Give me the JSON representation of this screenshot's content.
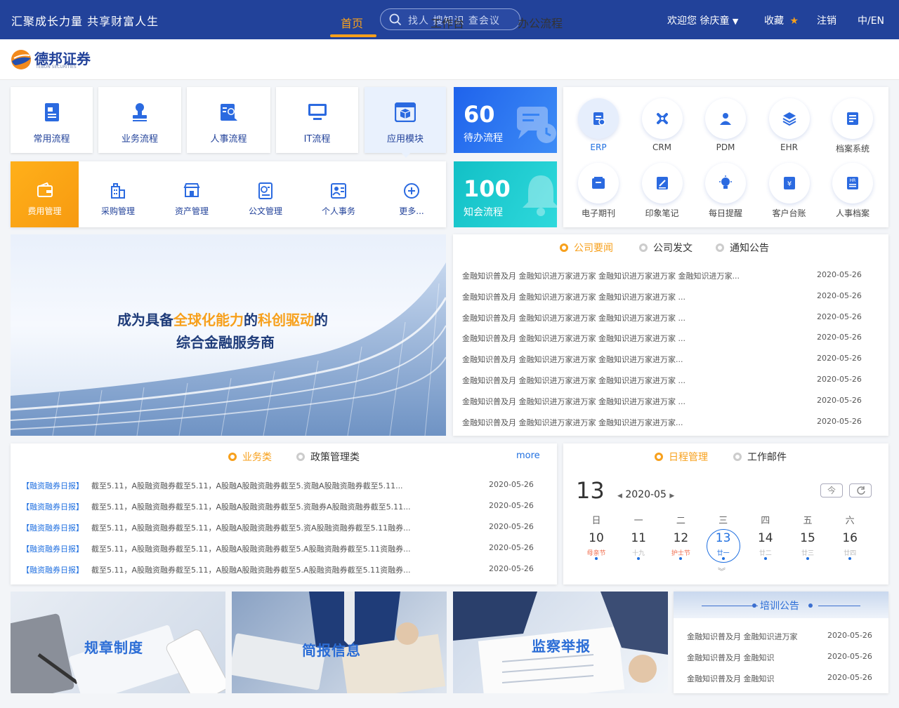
{
  "header": {
    "slogan": "汇聚成长力量 共享财富人生",
    "search_placeholder": "找人 搜知识 查会议",
    "welcome": "欢迎您 徐庆童",
    "favorites": "收藏",
    "logout": "注销",
    "language": "中/EN"
  },
  "brand": {
    "name_cn": "德邦证券",
    "name_en": "TEBON SECURITIES"
  },
  "nav": {
    "tabs": [
      "首页",
      "工作台",
      "办公流程"
    ],
    "active": "首页"
  },
  "modules_row1": [
    "常用流程",
    "业务流程",
    "人事流程",
    "IT流程",
    "应用模块"
  ],
  "modules_row2": [
    "费用管理",
    "采购管理",
    "资产管理",
    "公文管理",
    "个人事务",
    "更多..."
  ],
  "stats": {
    "pending": {
      "count": "60",
      "label": "待办流程"
    },
    "notify": {
      "count": "100",
      "label": "知会流程"
    }
  },
  "apps": [
    "ERP",
    "CRM",
    "PDM",
    "EHR",
    "档案系统",
    "电子期刊",
    "印象笔记",
    "每日提醒",
    "客户台账",
    "人事档案"
  ],
  "banner": {
    "line1_a": "成为具备",
    "line1_b": "全球化能力",
    "line1_c": "的",
    "line1_d": "科创驱动",
    "line1_e": "的",
    "line2": "综合金融服务商"
  },
  "news": {
    "tabs": [
      "公司要闻",
      "公司发文",
      "通知公告"
    ],
    "items": [
      {
        "text": "金融知识普及月  金融知识进万家进万家  金融知识进万家进万家 金融知识进万家...",
        "date": "2020-05-26"
      },
      {
        "text": "金融知识普及月  金融知识进万家进万家  金融知识进万家进万家 ...",
        "date": "2020-05-26"
      },
      {
        "text": "金融知识普及月  金融知识进万家进万家  金融知识进万家进万家 ...",
        "date": "2020-05-26"
      },
      {
        "text": "金融知识普及月  金融知识进万家进万家  金融知识进万家进万家 ...",
        "date": "2020-05-26"
      },
      {
        "text": "金融知识普及月  金融知识进万家进万家  金融知识进万家进万家...",
        "date": "2020-05-26"
      },
      {
        "text": "金融知识普及月  金融知识进万家进万家  金融知识进万家进万家 ...",
        "date": "2020-05-26"
      },
      {
        "text": "金融知识普及月  金融知识进万家进万家  金融知识进万家进万家 ...",
        "date": "2020-05-26"
      },
      {
        "text": "金融知识普及月  金融知识进万家进万家  金融知识进万家进万家...",
        "date": "2020-05-26"
      }
    ]
  },
  "business": {
    "tabs": [
      "业务类",
      "政策管理类"
    ],
    "more": "more",
    "items": [
      {
        "tag": "【融资融券日报】",
        "text": "截至5.11，A股融资融券截至5.11，A股融A股融资融券截至5.资融A股融资融券截至5.11...",
        "date": "2020-05-26"
      },
      {
        "tag": "【融资融券日报】",
        "text": "截至5.11，A股融资融券截至5.11，A股融A股融资融券截至5.资融券A股融资融券截至5.11...",
        "date": "2020-05-26"
      },
      {
        "tag": "【融资融券日报】",
        "text": "截至5.11，A股融资融券截至5.11，A股融A股融资融券截至5.资A股融资融券截至5.11融券...",
        "date": "2020-05-26"
      },
      {
        "tag": "【融资融券日报】",
        "text": "截至5.11，A股融资融券截至5.11，A股融A股融资融券截至5.A股融资融券截至5.11资融券...",
        "date": "2020-05-26"
      },
      {
        "tag": "【融资融券日报】",
        "text": "截至5.11，A股融资融券截至5.11，A股融A股融资融券截至5.A股融资融券截至5.11资融券...",
        "date": "2020-05-26"
      }
    ]
  },
  "schedule": {
    "tabs": [
      "日程管理",
      "工作邮件"
    ],
    "today": "13",
    "month": "2020-05",
    "today_btn": "今",
    "weekdays": [
      "日",
      "一",
      "二",
      "三",
      "四",
      "五",
      "六"
    ],
    "days": [
      {
        "d": "10",
        "sub": "母亲节",
        "holiday": true,
        "dot": true
      },
      {
        "d": "11",
        "sub": "十九",
        "holiday": false,
        "dot": true
      },
      {
        "d": "12",
        "sub": "护士节",
        "holiday": true,
        "dot": true
      },
      {
        "d": "13",
        "sub": "廿一",
        "holiday": false,
        "dot": true,
        "selected": true
      },
      {
        "d": "14",
        "sub": "廿二",
        "holiday": false,
        "dot": true
      },
      {
        "d": "15",
        "sub": "廿三",
        "holiday": false,
        "dot": true
      },
      {
        "d": "16",
        "sub": "廿四",
        "holiday": false,
        "dot": true
      }
    ]
  },
  "bottom": {
    "cards": [
      "规章制度",
      "简报信息",
      "监察举报"
    ],
    "training": {
      "title": "培训公告",
      "items": [
        {
          "text": "金融知识普及月  金融知识进万家",
          "date": "2020-05-26"
        },
        {
          "text": "金融知识普及月  金融知识",
          "date": "2020-05-26"
        },
        {
          "text": "金融知识普及月  金融知识",
          "date": "2020-05-26"
        }
      ]
    }
  },
  "colors": {
    "primary": "#22429a",
    "accent": "#f7a01c",
    "link": "#1f6fe0"
  }
}
